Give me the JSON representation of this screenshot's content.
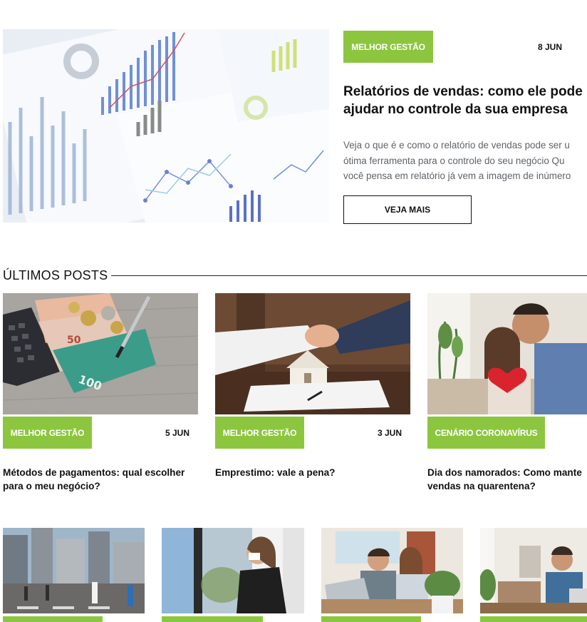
{
  "featured": {
    "tag": "MELHOR GESTÃO",
    "date": "8 JUN",
    "title": "Relatórios de vendas: como ele pode\najudar no controle da sua empresa",
    "excerpt": "Veja o que é e como o relatório de vendas pode ser u\nótima ferramenta para o controle do seu negócio Qu\nvocê pensa em relatório já vem a imagem de inúmero",
    "button": "VEJA MAIS",
    "image": "sales-report-charts"
  },
  "latest": {
    "heading": "ÚLTIMOS POSTS",
    "posts": [
      {
        "tag": "MELHOR GESTÃO",
        "date": "5 JUN",
        "title": "Métodos de pagamentos: qual escolher\npara o meu negócio?",
        "image": "money-calculator"
      },
      {
        "tag": "MELHOR GESTÃO",
        "date": "3 JUN",
        "title": "Emprestimo: vale a pena?",
        "image": "handshake-house"
      },
      {
        "tag": "CENÁRIO CORONAVÍRUS",
        "date": "",
        "title": "Dia dos namorados: Como mante\nvendas na quarentena?",
        "image": "couple-gift"
      }
    ],
    "row2_images": [
      "city-street",
      "woman-mask-window",
      "couple-laptop",
      "man-video-call"
    ]
  },
  "colors": {
    "accent": "#8cc63f",
    "text": "#111111",
    "muted": "#5f6368"
  }
}
